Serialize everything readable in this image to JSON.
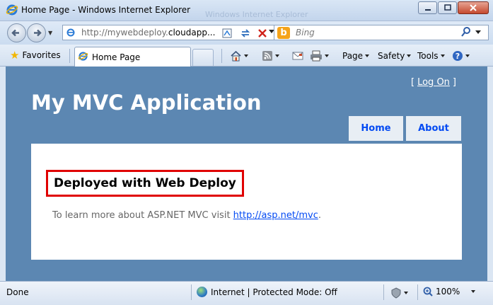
{
  "window": {
    "title": "Home Page - Windows Internet Explorer",
    "ghost_title": "Windows Internet Explorer"
  },
  "address_bar": {
    "url_prefix": "http://mywebdeploy.",
    "url_domain": "cloudapp..."
  },
  "search": {
    "placeholder": "Bing"
  },
  "favorites_bar": {
    "favorites_label": "Favorites",
    "tab_label": "Home Page"
  },
  "command_bar": {
    "page_label": "Page",
    "safety_label": "Safety",
    "tools_label": "Tools"
  },
  "site": {
    "logon_open": "[",
    "logon_label": "Log On",
    "logon_close": "]",
    "title": "My MVC Application",
    "menu": [
      {
        "label": "Home"
      },
      {
        "label": "About"
      }
    ],
    "heading": "Deployed with Web Deploy",
    "intro_text": "To learn more about ASP.NET MVC visit ",
    "intro_link": "http://asp.net/mvc",
    "intro_suffix": "."
  },
  "status_bar": {
    "status": "Done",
    "zone": "Internet | Protected Mode: Off",
    "zoom": "100%"
  },
  "colors": {
    "site_background": "#5c87b2",
    "menu_link": "#034af3",
    "highlight_border": "#e00000"
  }
}
